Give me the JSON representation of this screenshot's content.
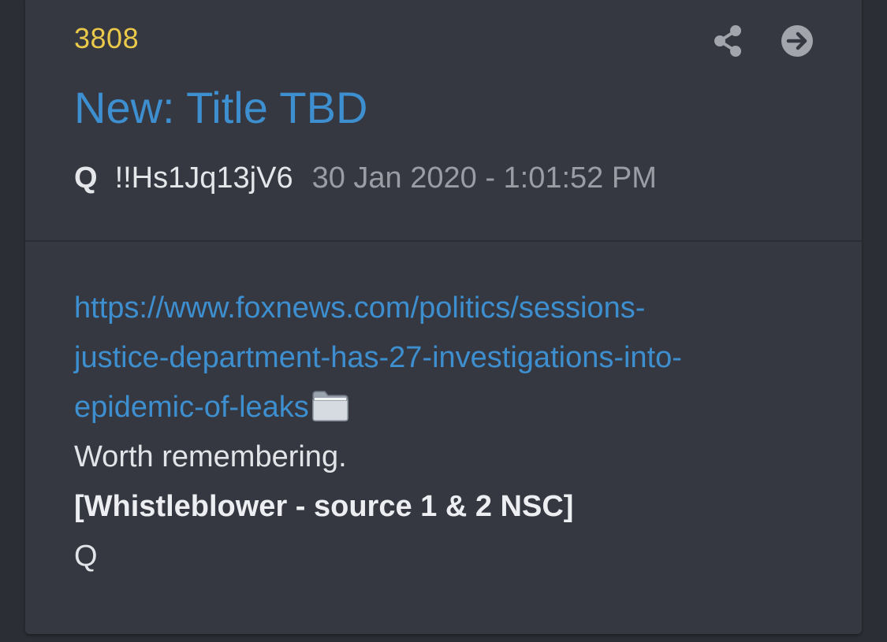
{
  "post": {
    "number": "3808",
    "title": "New: Title TBD",
    "author": "Q",
    "tripcode": "!!Hs1Jq13jV6",
    "timestamp": "30 Jan 2020 - 1:01:52 PM"
  },
  "body": {
    "link_line_1": "https://www.foxnews.com/politics/sessions-",
    "link_line_2": "justice-department-has-27-investigations-into-",
    "link_line_3": "epidemic-of-leaks",
    "line_worth": "Worth remembering.",
    "line_whistleblower": "[Whistleblower - source 1 & 2 NSC]",
    "signature": "Q"
  },
  "icons": {
    "share": "share-icon",
    "go": "arrow-right-circle-icon",
    "folder": "folder-icon"
  },
  "colors": {
    "post_number": "#e9c84a",
    "link": "#3d8fd0",
    "card_bg": "#353841",
    "page_bg": "#2b2e34"
  }
}
